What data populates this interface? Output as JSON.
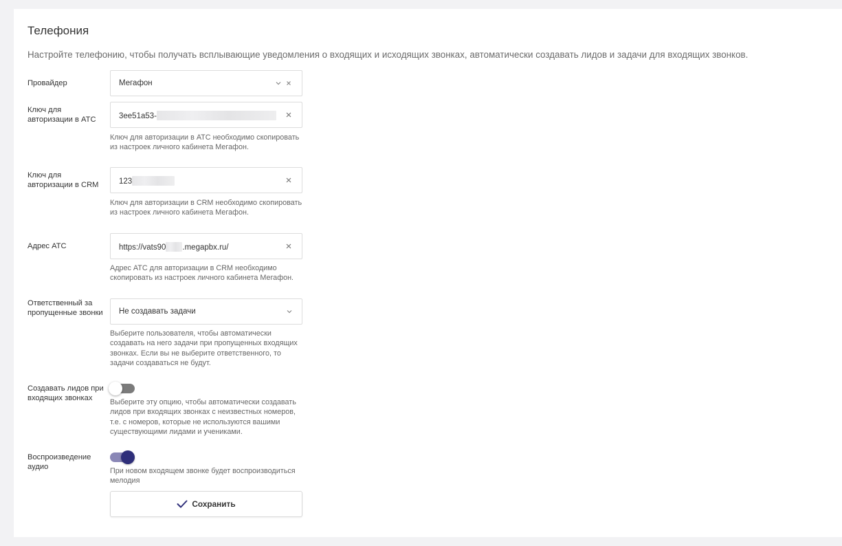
{
  "page": {
    "title": "Телефония",
    "description": "Настройте телефонию, чтобы получать всплывающие уведомления о входящих и исходящих звонках, автоматически создавать лидов и задачи для входящих звонков."
  },
  "provider": {
    "label": "Провайдер",
    "value": "Мегафон"
  },
  "ats_key": {
    "label": "Ключ для авторизации в АТС",
    "value": "3ee51a53-",
    "hint": "Ключ для авторизации в АТС необходимо скопировать из настроек личного кабинета Мегафон."
  },
  "crm_key": {
    "label": "Ключ для авторизации в CRM",
    "value": "123",
    "hint": "Ключ для авторизации в CRM необходимо скопировать из настроек личного кабинета Мегафон."
  },
  "ats_address": {
    "label": "Адрес АТС",
    "value_prefix": "https://vats90",
    "value_suffix": ".megapbx.ru/",
    "hint": "Адрес АТС для авторизации в CRM необходимо скопировать из настроек личного кабинета Мегафон."
  },
  "missed_calls": {
    "label": "Ответственный за пропущенные звонки",
    "value": "Не создавать задачи",
    "hint": "Выберите пользователя, чтобы автоматически создавать на него задачи при пропущенных входящих звонках. Если вы не выберите ответственного, то задачи создаваться не будут."
  },
  "create_leads": {
    "label": "Создавать лидов при входящих звонках",
    "enabled": false,
    "hint": "Выберите эту опцию, чтобы автоматически создавать лидов при входящих звонках с неизвестных номеров, т.е. с номеров, которые не используются вашими существующими лидами и учениками."
  },
  "audio_playback": {
    "label": "Воспроизведение аудио",
    "enabled": true,
    "hint": "При новом входящем звонке будет воспроизводиться мелодия"
  },
  "save": {
    "label": "Сохранить"
  },
  "icons": {
    "clear": "close-icon",
    "dropdown": "chevron-down-icon",
    "save": "check-icon"
  },
  "colors": {
    "accent": "#2f2f7a",
    "toggle_on_track": "#8a87b6",
    "toggle_off_track": "#7b7b7b",
    "background": "#f2f2f4"
  }
}
